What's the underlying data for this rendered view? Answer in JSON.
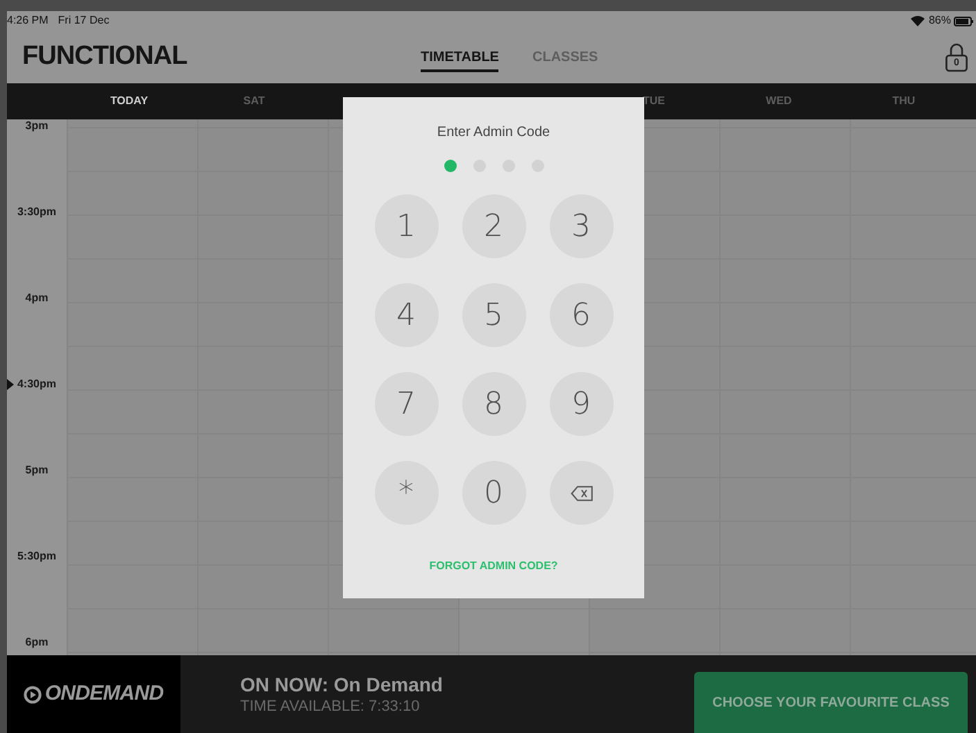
{
  "status_bar": {
    "time": "4:26 PM",
    "date": "Fri 17 Dec",
    "battery": "86%"
  },
  "header": {
    "title": "FUNCTIONAL",
    "tabs": [
      {
        "label": "TIMETABLE",
        "selected": true
      },
      {
        "label": "CLASSES",
        "selected": false
      }
    ],
    "lock_count": "0"
  },
  "days_left": [
    {
      "label": "TODAY",
      "selected": true
    },
    {
      "label": "SAT",
      "selected": false
    }
  ],
  "days_right": [
    {
      "label": "TUE",
      "selected": false
    },
    {
      "label": "WED",
      "selected": false
    },
    {
      "label": "THU",
      "selected": false
    }
  ],
  "time_slots": [
    {
      "label": "3pm",
      "current": false
    },
    {
      "label": "3:30pm",
      "current": false
    },
    {
      "label": "4pm",
      "current": false
    },
    {
      "label": "4:30pm",
      "current": true
    },
    {
      "label": "5pm",
      "current": false
    },
    {
      "label": "5:30pm",
      "current": false
    },
    {
      "label": "6pm",
      "current": false
    }
  ],
  "admin_dialog": {
    "title": "Enter Admin Code",
    "code_dots": [
      {
        "filled": true
      },
      {
        "filled": false
      },
      {
        "filled": false
      },
      {
        "filled": false
      }
    ],
    "keys": [
      {
        "kind": "digit",
        "label": "1"
      },
      {
        "kind": "digit",
        "label": "2"
      },
      {
        "kind": "digit",
        "label": "3"
      },
      {
        "kind": "digit",
        "label": "4"
      },
      {
        "kind": "digit",
        "label": "5"
      },
      {
        "kind": "digit",
        "label": "6"
      },
      {
        "kind": "digit",
        "label": "7"
      },
      {
        "kind": "digit",
        "label": "8"
      },
      {
        "kind": "digit",
        "label": "9"
      },
      {
        "kind": "digit",
        "label": "*"
      },
      {
        "kind": "digit",
        "label": "0"
      },
      {
        "kind": "delete"
      }
    ],
    "forgot_link": "FORGOT ADMIN CODE?"
  },
  "footer": {
    "logo": "ONDEMAND",
    "now_on": "ON NOW: On Demand",
    "time_available": "TIME AVAILABLE: 7:33:10",
    "button": "CHOOSE YOUR FAVOURITE CLASS"
  }
}
